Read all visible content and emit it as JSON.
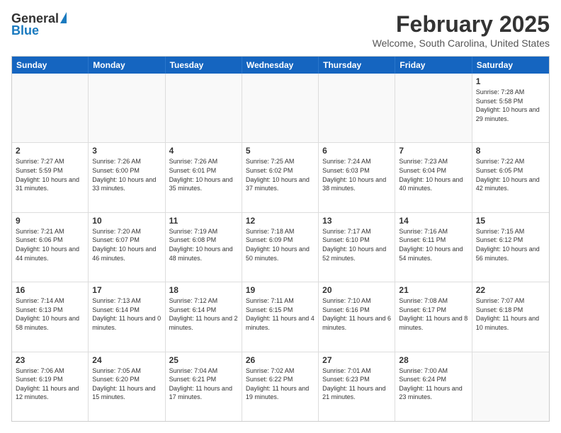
{
  "logo": {
    "general": "General",
    "blue": "Blue"
  },
  "title": "February 2025",
  "location": "Welcome, South Carolina, United States",
  "days": [
    "Sunday",
    "Monday",
    "Tuesday",
    "Wednesday",
    "Thursday",
    "Friday",
    "Saturday"
  ],
  "rows": [
    [
      {
        "day": "",
        "text": "",
        "empty": true
      },
      {
        "day": "",
        "text": "",
        "empty": true
      },
      {
        "day": "",
        "text": "",
        "empty": true
      },
      {
        "day": "",
        "text": "",
        "empty": true
      },
      {
        "day": "",
        "text": "",
        "empty": true
      },
      {
        "day": "",
        "text": "",
        "empty": true
      },
      {
        "day": "1",
        "text": "Sunrise: 7:28 AM\nSunset: 5:58 PM\nDaylight: 10 hours and 29 minutes."
      }
    ],
    [
      {
        "day": "2",
        "text": "Sunrise: 7:27 AM\nSunset: 5:59 PM\nDaylight: 10 hours and 31 minutes."
      },
      {
        "day": "3",
        "text": "Sunrise: 7:26 AM\nSunset: 6:00 PM\nDaylight: 10 hours and 33 minutes."
      },
      {
        "day": "4",
        "text": "Sunrise: 7:26 AM\nSunset: 6:01 PM\nDaylight: 10 hours and 35 minutes."
      },
      {
        "day": "5",
        "text": "Sunrise: 7:25 AM\nSunset: 6:02 PM\nDaylight: 10 hours and 37 minutes."
      },
      {
        "day": "6",
        "text": "Sunrise: 7:24 AM\nSunset: 6:03 PM\nDaylight: 10 hours and 38 minutes."
      },
      {
        "day": "7",
        "text": "Sunrise: 7:23 AM\nSunset: 6:04 PM\nDaylight: 10 hours and 40 minutes."
      },
      {
        "day": "8",
        "text": "Sunrise: 7:22 AM\nSunset: 6:05 PM\nDaylight: 10 hours and 42 minutes."
      }
    ],
    [
      {
        "day": "9",
        "text": "Sunrise: 7:21 AM\nSunset: 6:06 PM\nDaylight: 10 hours and 44 minutes."
      },
      {
        "day": "10",
        "text": "Sunrise: 7:20 AM\nSunset: 6:07 PM\nDaylight: 10 hours and 46 minutes."
      },
      {
        "day": "11",
        "text": "Sunrise: 7:19 AM\nSunset: 6:08 PM\nDaylight: 10 hours and 48 minutes."
      },
      {
        "day": "12",
        "text": "Sunrise: 7:18 AM\nSunset: 6:09 PM\nDaylight: 10 hours and 50 minutes."
      },
      {
        "day": "13",
        "text": "Sunrise: 7:17 AM\nSunset: 6:10 PM\nDaylight: 10 hours and 52 minutes."
      },
      {
        "day": "14",
        "text": "Sunrise: 7:16 AM\nSunset: 6:11 PM\nDaylight: 10 hours and 54 minutes."
      },
      {
        "day": "15",
        "text": "Sunrise: 7:15 AM\nSunset: 6:12 PM\nDaylight: 10 hours and 56 minutes."
      }
    ],
    [
      {
        "day": "16",
        "text": "Sunrise: 7:14 AM\nSunset: 6:13 PM\nDaylight: 10 hours and 58 minutes."
      },
      {
        "day": "17",
        "text": "Sunrise: 7:13 AM\nSunset: 6:14 PM\nDaylight: 11 hours and 0 minutes."
      },
      {
        "day": "18",
        "text": "Sunrise: 7:12 AM\nSunset: 6:14 PM\nDaylight: 11 hours and 2 minutes."
      },
      {
        "day": "19",
        "text": "Sunrise: 7:11 AM\nSunset: 6:15 PM\nDaylight: 11 hours and 4 minutes."
      },
      {
        "day": "20",
        "text": "Sunrise: 7:10 AM\nSunset: 6:16 PM\nDaylight: 11 hours and 6 minutes."
      },
      {
        "day": "21",
        "text": "Sunrise: 7:08 AM\nSunset: 6:17 PM\nDaylight: 11 hours and 8 minutes."
      },
      {
        "day": "22",
        "text": "Sunrise: 7:07 AM\nSunset: 6:18 PM\nDaylight: 11 hours and 10 minutes."
      }
    ],
    [
      {
        "day": "23",
        "text": "Sunrise: 7:06 AM\nSunset: 6:19 PM\nDaylight: 11 hours and 12 minutes."
      },
      {
        "day": "24",
        "text": "Sunrise: 7:05 AM\nSunset: 6:20 PM\nDaylight: 11 hours and 15 minutes."
      },
      {
        "day": "25",
        "text": "Sunrise: 7:04 AM\nSunset: 6:21 PM\nDaylight: 11 hours and 17 minutes."
      },
      {
        "day": "26",
        "text": "Sunrise: 7:02 AM\nSunset: 6:22 PM\nDaylight: 11 hours and 19 minutes."
      },
      {
        "day": "27",
        "text": "Sunrise: 7:01 AM\nSunset: 6:23 PM\nDaylight: 11 hours and 21 minutes."
      },
      {
        "day": "28",
        "text": "Sunrise: 7:00 AM\nSunset: 6:24 PM\nDaylight: 11 hours and 23 minutes."
      },
      {
        "day": "",
        "text": "",
        "empty": true
      }
    ]
  ]
}
